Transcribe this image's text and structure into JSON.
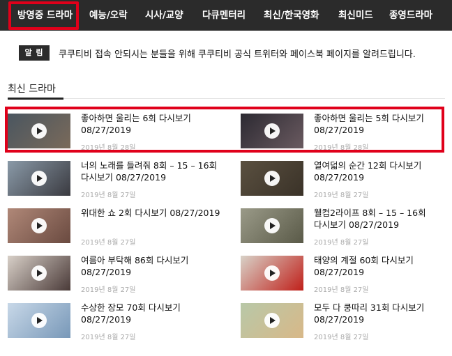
{
  "nav": {
    "items": [
      {
        "label": "방영중 드라마",
        "active": true
      },
      {
        "label": "예능/오락"
      },
      {
        "label": "시사/교양"
      },
      {
        "label": "다큐멘터리"
      },
      {
        "label": "최신/한국영화"
      },
      {
        "label": "최신미드"
      },
      {
        "label": "종영드라마"
      }
    ]
  },
  "notice": {
    "badge": "알 림",
    "text": "쿠쿠티비 접속 안되시는 분들을 위해 쿠쿠티비 공식 트위터와 페이스북 페이지를 알려드립니다."
  },
  "section": {
    "title": "최신 드라마"
  },
  "cards": [
    {
      "title": "좋아하면 울리는 6회 다시보기 08/27/2019",
      "date": "2019년 8월 28일",
      "thumb": [
        "#4a5660",
        "#7a6a5a"
      ]
    },
    {
      "title": "좋아하면 울리는 5회 다시보기 08/27/2019",
      "date": "2019년 8월 28일",
      "thumb": [
        "#2c2a32",
        "#6a5a60"
      ]
    },
    {
      "title": "너의 노래를 들려줘 8회 – 15 – 16회 다시보기 08/27/2019",
      "date": "2019년 8월 27일",
      "thumb": [
        "#8a9aa8",
        "#3a3a40"
      ]
    },
    {
      "title": "열여덟의 순간 12회 다시보기 08/27/2019",
      "date": "2019년 8월 27일",
      "thumb": [
        "#5a5040",
        "#3a3228"
      ]
    },
    {
      "title": "위대한 쇼 2회 다시보기 08/27/2019",
      "date": "2019년 8월 27일",
      "thumb": [
        "#b08878",
        "#6a4a40"
      ]
    },
    {
      "title": "웰컴2라이프 8회 – 15 – 16회 다시보기 08/27/2019",
      "date": "2019년 8월 27일",
      "thumb": [
        "#9a9a88",
        "#5a5a48"
      ]
    },
    {
      "title": "여름아 부탁해 86회 다시보기 08/27/2019",
      "date": "2019년 8월 27일",
      "thumb": [
        "#d8d0c8",
        "#4a3a38"
      ]
    },
    {
      "title": "태양의 계절 60회 다시보기 08/27/2019",
      "date": "2019년 8월 27일",
      "thumb": [
        "#d8d2c8",
        "#c0201a"
      ]
    },
    {
      "title": "수상한 장모 70회 다시보기 08/27/2019",
      "date": "2019년 8월 27일",
      "thumb": [
        "#c8d8e8",
        "#7898b8"
      ]
    },
    {
      "title": "모두 다 쿵따리 31회 다시보기 08/27/2019",
      "date": "2019년 8월 27일",
      "thumb": [
        "#b8c8a8",
        "#d8b888"
      ]
    }
  ]
}
